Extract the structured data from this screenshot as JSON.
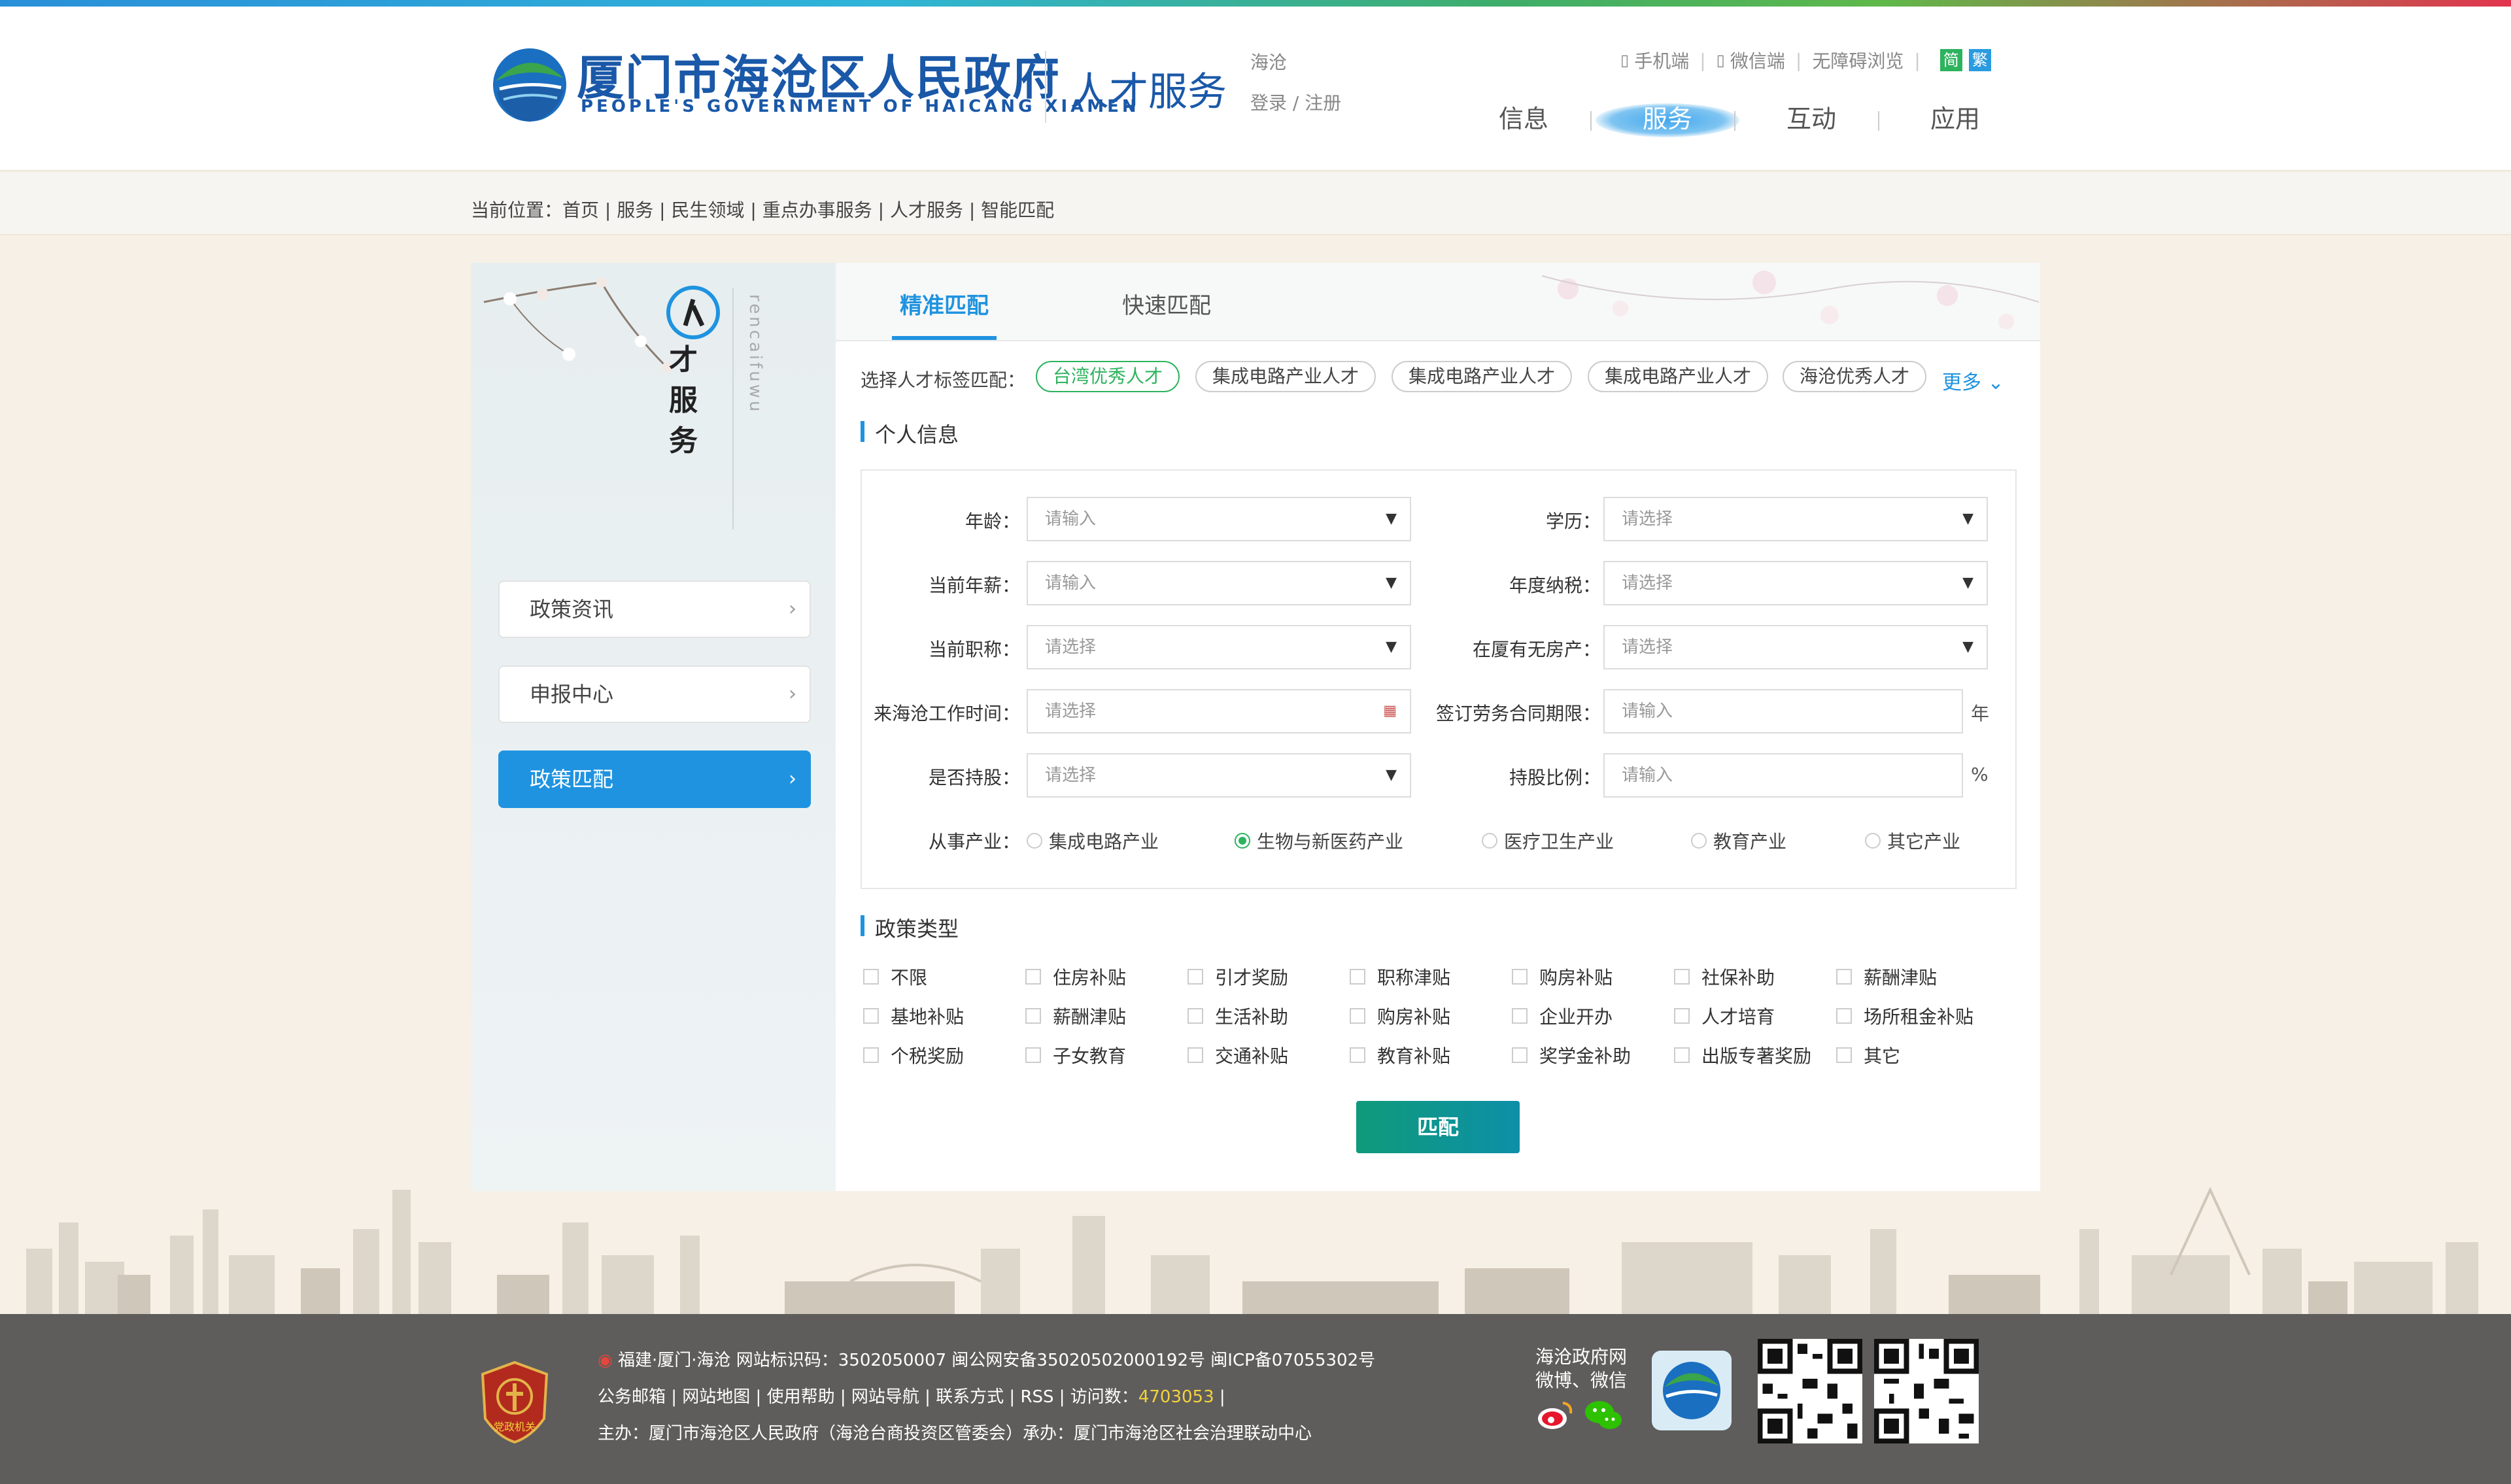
{
  "header": {
    "site_title": "厦门市海沧区人民政府",
    "site_title_en": "PEOPLE'S GOVERNMENT OF HAICANG XIAMEN",
    "sub_title": "人才服务",
    "region": "海沧",
    "login": "登录",
    "register": "注册",
    "mobile": "手机端",
    "wechat": "微信端",
    "accessibility": "无障碍浏览",
    "lang_simple": "简",
    "lang_traditional": "繁",
    "nav": [
      "信息",
      "服务",
      "互动",
      "应用"
    ],
    "nav_active_index": 1
  },
  "breadcrumb": "当前位置：首页 | 服务 | 民生领域 | 重点办事服务 | 人才服务 | 智能匹配",
  "sidebar": {
    "title_chars": [
      "人",
      "才",
      "服",
      "务"
    ],
    "pinyin": "rencaifuwu",
    "menu": [
      "政策资讯",
      "申报中心",
      "政策匹配"
    ],
    "active_index": 2
  },
  "tabs": [
    "精准匹配",
    "快速匹配"
  ],
  "active_tab": 0,
  "tags": {
    "label": "选择人才标签匹配：",
    "items": [
      "台湾优秀人才",
      "集成电路产业人才",
      "集成电路产业人才",
      "集成电路产业人才",
      "海沧优秀人才"
    ],
    "active_index": 0,
    "more": "更多"
  },
  "personal": {
    "title": "个人信息",
    "fields": {
      "age": {
        "label": "年龄：",
        "placeholder": "请输入"
      },
      "edu": {
        "label": "学历：",
        "placeholder": "请选择"
      },
      "salary": {
        "label": "当前年薪：",
        "placeholder": "请输入"
      },
      "tax": {
        "label": "年度纳税：",
        "placeholder": "请选择"
      },
      "title": {
        "label": "当前职称：",
        "placeholder": "请选择"
      },
      "house": {
        "label": "在厦有无房产：",
        "placeholder": "请选择"
      },
      "worktime": {
        "label": "来海沧工作时间：",
        "placeholder": "请选择"
      },
      "contract": {
        "label": "签订劳务合同期限：",
        "placeholder": "请输入",
        "unit": "年"
      },
      "shares": {
        "label": "是否持股：",
        "placeholder": "请选择"
      },
      "ratio": {
        "label": "持股比例：",
        "placeholder": "请输入",
        "unit": "%"
      }
    },
    "industry": {
      "label": "从事产业：",
      "options": [
        "集成电路产业",
        "生物与新医药产业",
        "医疗卫生产业",
        "教育产业",
        "其它产业"
      ],
      "selected_index": 1
    }
  },
  "policy": {
    "title": "政策类型",
    "options": [
      "不限",
      "住房补贴",
      "引才奖励",
      "职称津贴",
      "购房补贴",
      "社保补助",
      "薪酬津贴",
      "基地补贴",
      "薪酬津贴",
      "生活补助",
      "购房补贴",
      "企业开办",
      "人才培育",
      "场所租金补贴",
      "个税奖励",
      "子女教育",
      "交通补贴",
      "教育补贴",
      "奖学金补助",
      "出版专著奖励",
      "其它"
    ]
  },
  "match_button": "匹配",
  "footer": {
    "line1_a": "福建·厦门·海沧   网站标识码：3502050007    闽公网安备35020502000192号   闽ICP备07055302号",
    "line2_a": "公务邮箱 | 网站地图 | 使用帮助 | 网站导航 | 联系方式 | RSS | 访问数：",
    "visits": "4703053",
    "line2_b": " |",
    "line3": "主办：厦门市海沧区人民政府（海沧台商投资区管委会）承办：厦门市海沧区社会治理联动中心",
    "social_label_1": "海沧政府网",
    "social_label_2": "微博、微信",
    "badge_text": "党政机关"
  },
  "colors": {
    "primary": "#1f93e0",
    "green": "#2db35e",
    "brand_blue": "#1a58a8",
    "footer_bg": "#5e5d5c"
  }
}
